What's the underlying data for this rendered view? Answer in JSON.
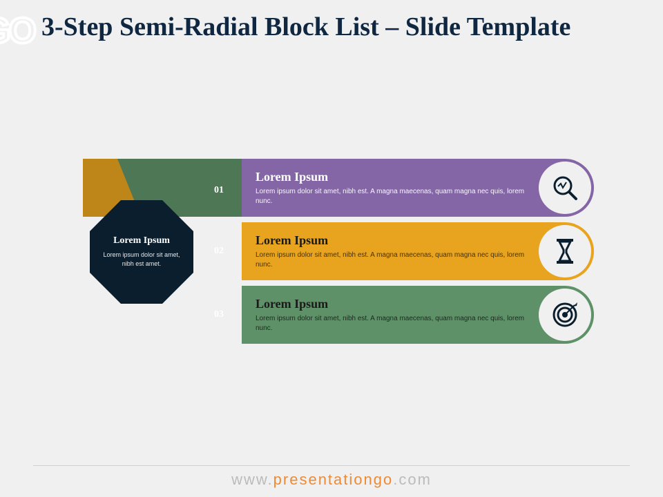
{
  "branding": {
    "badge": "GO",
    "footer_prefix": "www.",
    "footer_main": "presentationgo",
    "footer_suffix": ".com"
  },
  "title": "3-Step Semi-Radial Block List – Slide Template",
  "hub": {
    "title": "Lorem Ipsum",
    "desc": "Lorem ipsum dolor sit amet, nibh est amet."
  },
  "steps": [
    {
      "num": "01",
      "title": "Lorem Ipsum",
      "desc": "Lorem ipsum dolor sit amet, nibh est. A magna maecenas, quam magna nec quis, lorem nunc.",
      "color": "#8466a6",
      "icon": "search-analytics"
    },
    {
      "num": "02",
      "title": "Lorem Ipsum",
      "desc": "Lorem ipsum dolor sit amet, nibh est. A magna maecenas, quam magna nec quis, lorem nunc.",
      "color": "#e8a41e",
      "icon": "hourglass"
    },
    {
      "num": "03",
      "title": "Lorem Ipsum",
      "desc": "Lorem ipsum dolor sit amet, nibh est. A magna maecenas, quam magna nec quis, lorem nunc.",
      "color": "#5e9168",
      "icon": "target"
    }
  ]
}
